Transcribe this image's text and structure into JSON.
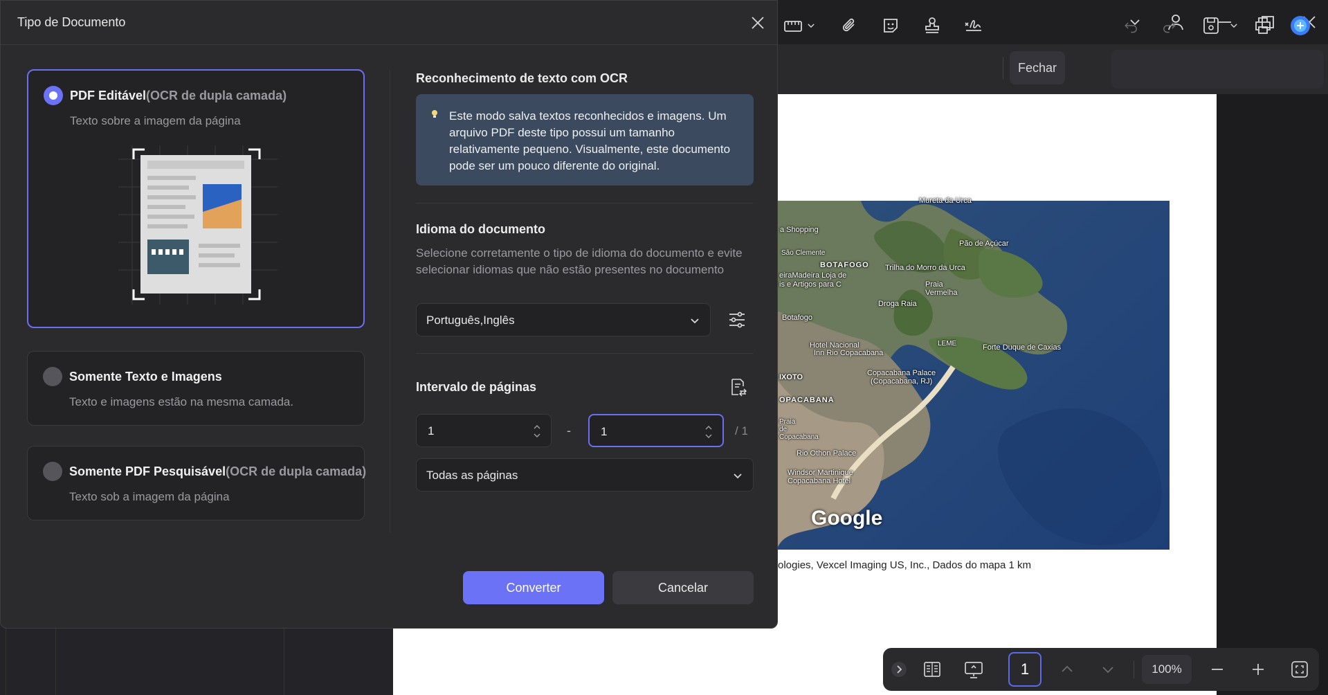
{
  "dialog": {
    "title": "Tipo de Documento",
    "close_icon": "close-icon",
    "options": [
      {
        "title": "PDF Editável",
        "title_suffix": "(OCR de dupla camada)",
        "subtitle": "Texto sobre a imagem da página",
        "selected": true
      },
      {
        "title": "Somente Texto e Imagens",
        "title_suffix": "",
        "subtitle": "Texto e imagens estão na mesma camada.",
        "selected": false
      },
      {
        "title": "Somente PDF Pesquisável",
        "title_suffix": "(OCR de dupla camada)",
        "subtitle": "Texto sob a imagem da página",
        "selected": false
      }
    ],
    "ocr": {
      "title": "Reconhecimento de texto com OCR",
      "info": "Este modo salva textos reconhecidos e imagens. Um arquivo PDF deste tipo possui um tamanho relativamente pequeno. Visualmente, este documento pode ser um pouco diferente do original."
    },
    "language": {
      "title": "Idioma do documento",
      "description": "Selecione corretamente o tipo de idioma do documento e evite selecionar idiomas que não estão presentes no documento",
      "value": "Português,Inglês"
    },
    "page_range": {
      "title": "Intervalo de páginas",
      "from": "1",
      "separator": "-",
      "to": "1",
      "total": "/ 1",
      "scope": "Todas as páginas"
    },
    "buttons": {
      "convert": "Converter",
      "cancel": "Cancelar"
    }
  },
  "toolbar": {
    "close_label": "Fechar"
  },
  "document": {
    "map_credit": "ologies, Vexcel Imaging US, Inc., Dados do mapa   1 km",
    "map_logo": "Google",
    "map_labels": [
      {
        "text": "Mureta da Urca"
      },
      {
        "text": "a Shopping"
      },
      {
        "text": "São Clemente"
      },
      {
        "text": "BOTAFOGO"
      },
      {
        "text": "eiraMadeira  Loja de"
      },
      {
        "text": "is e Artigos para C"
      },
      {
        "text": "Trilha do Morro da Urca"
      },
      {
        "text": "Pão de Açúcar"
      },
      {
        "text": "Praia Vermelha"
      },
      {
        "text": "Droga Raia"
      },
      {
        "text": "Botafogo"
      },
      {
        "text": "Hotel Nacional"
      },
      {
        "text": "Inn Rio Copacabana"
      },
      {
        "text": "LEME"
      },
      {
        "text": "Forte Duque de Caxias"
      },
      {
        "text": "Copacabana Palace"
      },
      {
        "text": "(Copacabana, RJ)"
      },
      {
        "text": "IXOTO"
      },
      {
        "text": "OPACABANA"
      },
      {
        "text": "Praia de Copacabana"
      },
      {
        "text": "Rio Othon Palace"
      },
      {
        "text": "Windsor Martinique"
      },
      {
        "text": "Copacabana Hotel"
      }
    ]
  },
  "bottom_bar": {
    "page_number": "1",
    "zoom": "100%"
  }
}
